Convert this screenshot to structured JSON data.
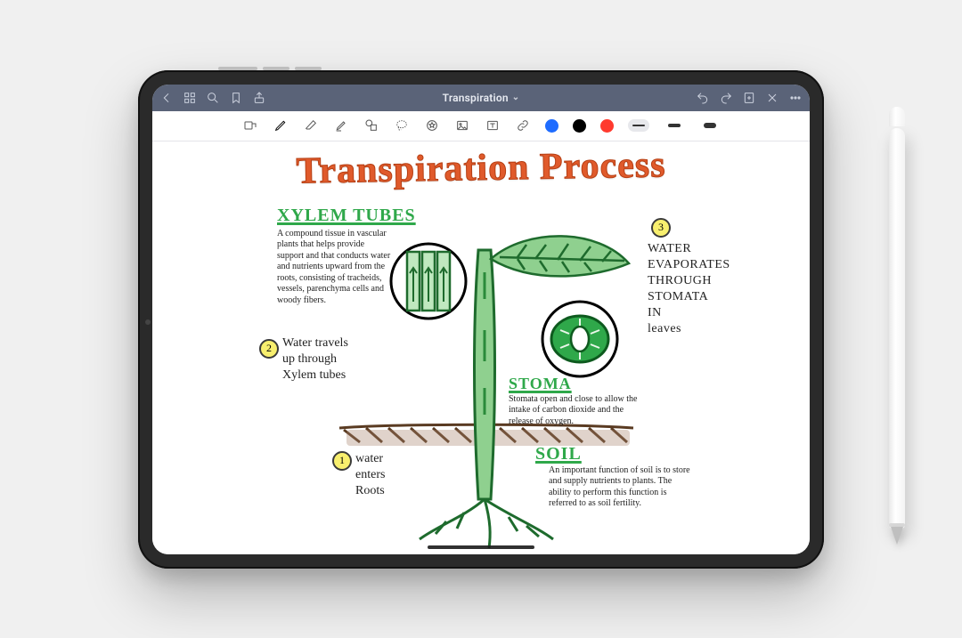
{
  "titlebar": {
    "doc_title": "Transpiration",
    "title_caret": "⌄"
  },
  "colors": {
    "titlebar_bg": "#5a6378",
    "accent_green": "#2fa84a",
    "accent_orange": "#e05a2b",
    "swatch_blue": "#1e6cff",
    "swatch_black": "#000000",
    "swatch_red": "#ff3a2e",
    "highlight_yellow": "#f8ef6e"
  },
  "note": {
    "title": "Transpiration Process",
    "xylem": {
      "heading": "XYLEM TUBES",
      "body": "A compound tissue in vascular plants that helps provide support and that conducts water and nutrients upward from the roots, consisting of tracheids, vessels, parenchyma cells and woody fibers."
    },
    "stoma": {
      "heading": "STOMA",
      "body": "Stomata open and close to allow the intake of carbon dioxide and the release of oxygen."
    },
    "soil": {
      "heading": "SOIL",
      "body": "An important function of soil is to store and supply nutrients to plants. The ability to perform this function is referred to as soil fertility."
    },
    "steps": {
      "s1_num": "1",
      "s1_text": "water\nenters\nRoots",
      "s2_num": "2",
      "s2_text": "Water travels\nup through\nXylem tubes",
      "s3_num": "3",
      "s3_text": "WATER\nEVAPORATES\nTHROUGH\nSTOMATA\nIN\nleaves"
    }
  }
}
